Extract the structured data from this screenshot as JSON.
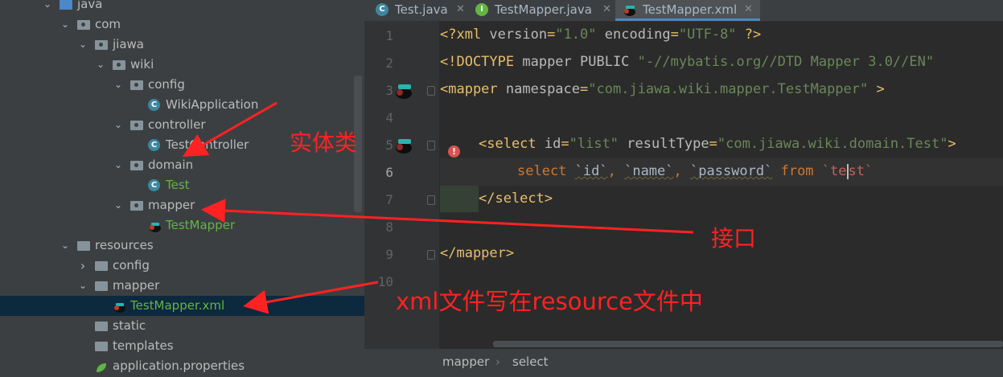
{
  "project_tree": {
    "items": [
      {
        "label": "java",
        "kind": "folder-src",
        "depth": 0,
        "expanded": true
      },
      {
        "label": "com",
        "kind": "package",
        "depth": 1,
        "expanded": true
      },
      {
        "label": "jiawa",
        "kind": "package",
        "depth": 2,
        "expanded": true
      },
      {
        "label": "wiki",
        "kind": "package",
        "depth": 3,
        "expanded": true
      },
      {
        "label": "config",
        "kind": "package",
        "depth": 4,
        "expanded": true
      },
      {
        "label": "WikiApplication",
        "kind": "spring-class",
        "depth": 5
      },
      {
        "label": "controller",
        "kind": "package",
        "depth": 4,
        "expanded": true
      },
      {
        "label": "TestController",
        "kind": "class",
        "depth": 5
      },
      {
        "label": "domain",
        "kind": "package",
        "depth": 4,
        "expanded": true
      },
      {
        "label": "Test",
        "kind": "class",
        "depth": 5,
        "modified": true
      },
      {
        "label": "mapper",
        "kind": "package",
        "depth": 4,
        "expanded": true
      },
      {
        "label": "TestMapper",
        "kind": "mybatis-interface",
        "depth": 5,
        "modified": true
      },
      {
        "label": "resources",
        "kind": "folder-res",
        "depth": 1,
        "expanded": true
      },
      {
        "label": "config",
        "kind": "folder",
        "depth": 2,
        "expanded": false
      },
      {
        "label": "mapper",
        "kind": "folder",
        "depth": 2,
        "expanded": true
      },
      {
        "label": "TestMapper.xml",
        "kind": "mybatis-xml",
        "depth": 3,
        "modified": true,
        "selected": true
      },
      {
        "label": "static",
        "kind": "folder",
        "depth": 2
      },
      {
        "label": "templates",
        "kind": "folder",
        "depth": 2
      },
      {
        "label": "application.properties",
        "kind": "properties",
        "depth": 2
      }
    ]
  },
  "tabs": [
    {
      "label": "Test.java",
      "icon": "class-icon",
      "active": false
    },
    {
      "label": "TestMapper.java",
      "icon": "interface-icon",
      "active": false
    },
    {
      "label": "TestMapper.xml",
      "icon": "mybatis-icon",
      "active": true
    }
  ],
  "editor": {
    "line_numbers": [
      "1",
      "2",
      "3",
      "4",
      "5",
      "6",
      "7",
      "8",
      "9",
      "10"
    ],
    "current_line": "6",
    "lines": {
      "l1": {
        "p1": "<?xml ",
        "p2": "version",
        "p3": "=",
        "p4": "\"1.0\"",
        "p5": " encoding",
        "p6": "=",
        "p7": "\"UTF-8\"",
        "p8": " ?>"
      },
      "l2": {
        "p1": "<!DOCTYPE ",
        "p2": "mapper PUBLIC ",
        "p3": "\"-//mybatis.org//DTD Mapper 3.0//EN\""
      },
      "l3": {
        "p1": "<mapper ",
        "p2": "namespace",
        "p3": "=",
        "p4": "\"com.jiawa.wiki.mapper.TestMapper\"",
        "p5": " >"
      },
      "l5": {
        "p1": "<select ",
        "p2": "id",
        "p3": "=",
        "p4": "\"list\"",
        "p5": " resultType",
        "p6": "=",
        "p7": "\"com.jiawa.wiki.domain.Test\"",
        "p8": ">"
      },
      "l6": {
        "p1": "select ",
        "p2": "`id`",
        "p3": ", ",
        "p4": "`name`",
        "p5": ", ",
        "p6": "`password`",
        "p7": " from ",
        "p8": "`te",
        "p9": "st`"
      },
      "l7": {
        "p1": "</select>"
      },
      "l9": {
        "p1": "</mapper>"
      }
    }
  },
  "breadcrumb": {
    "items": [
      "mapper",
      "select"
    ],
    "separator": "›"
  },
  "annotations": {
    "entity": "实体类",
    "interface": "接口",
    "xml_note": "xml文件写在resource文件中",
    "color": "#ff2222"
  },
  "colors": {
    "sidebar_bg": "#3c3f41",
    "editor_bg": "#2b2b2b",
    "xml_tag": "#e8bf6a",
    "string": "#6a8759",
    "keyword": "#cc7832",
    "selection": "#0d293e",
    "modified_file": "#62b543"
  }
}
